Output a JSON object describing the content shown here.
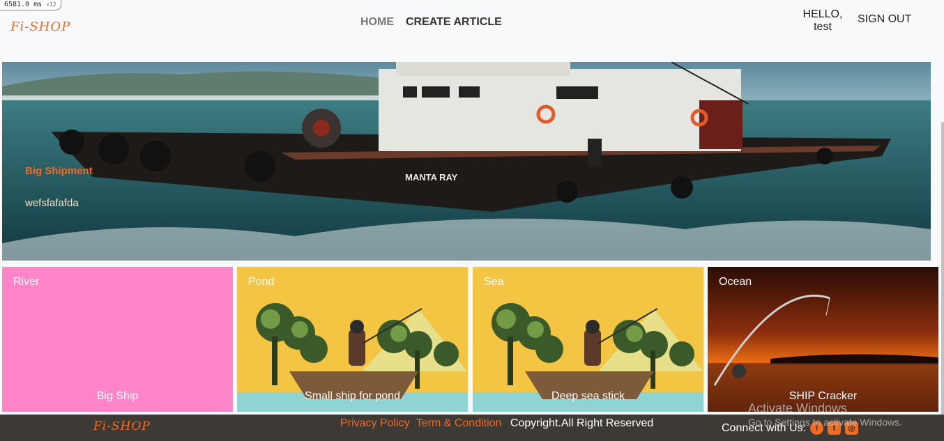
{
  "devtools": {
    "fps_value": "6581.0",
    "fps_unit": "ms",
    "fps_mult": "×12"
  },
  "header": {
    "logo": "Fi-SHOP",
    "nav": [
      {
        "label": "HOME"
      },
      {
        "label": "CREATE ARTICLE"
      }
    ],
    "greeting": "HELLO,",
    "username": "test",
    "sign_out": "SIGN OUT"
  },
  "hero": {
    "title": "Big Shipment",
    "subtitle": "wefsfafafda",
    "ship_name": "MANTA RAY"
  },
  "cards": [
    {
      "title": "River",
      "caption": "Big Ship"
    },
    {
      "title": "Pond",
      "caption": "Small ship for pond"
    },
    {
      "title": "Sea",
      "caption": "Deep sea stick"
    },
    {
      "title": "Ocean",
      "caption": "SHIP Cracker"
    }
  ],
  "footer": {
    "logo": "Fi-SHOP",
    "privacy": "Privacy Policy",
    "terms": "Term & Condition",
    "copyright": "Copyright.All Right Reserved",
    "connect": "Connect with Us:",
    "socials": [
      {
        "icon": "facebook-icon"
      },
      {
        "icon": "twitter-icon"
      },
      {
        "icon": "instagram-icon"
      }
    ]
  },
  "watermark": {
    "line1": "Activate Windows",
    "line2": "Go to Settings to activate Windows."
  },
  "colors": {
    "accent": "#f26b21",
    "footer_bg": "#3d3935",
    "river_bg": "#ff85c8",
    "pond_bg": "#f4c542"
  }
}
